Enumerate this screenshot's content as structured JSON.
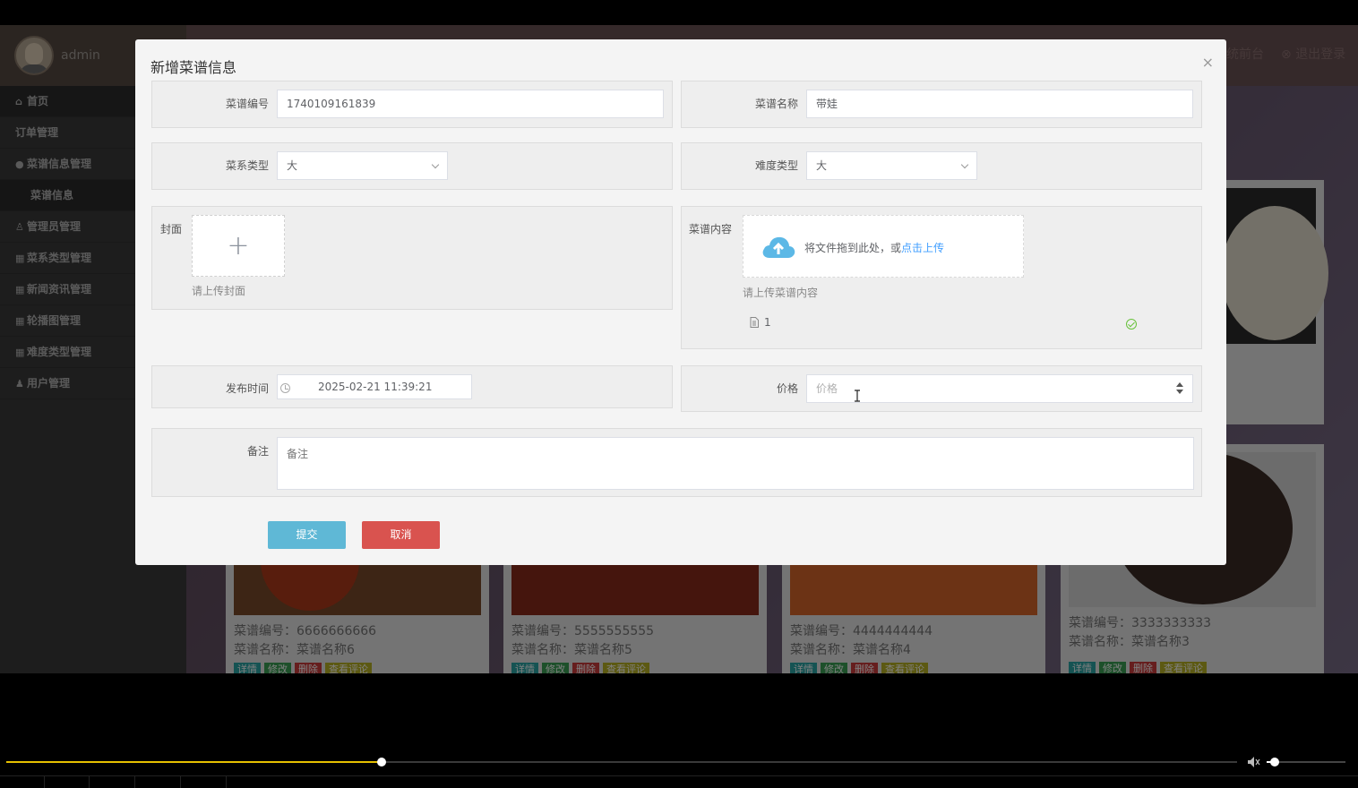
{
  "sidebar": {
    "user": "admin",
    "items": [
      {
        "label": "首页",
        "icon": "home-icon"
      },
      {
        "label": "订单管理",
        "icon": ""
      },
      {
        "label": "菜谱信息管理",
        "icon": "circle-icon"
      },
      {
        "label": "菜谱信息",
        "icon": ""
      },
      {
        "label": "管理员管理",
        "icon": "user-shield-icon"
      },
      {
        "label": "菜系类型管理",
        "icon": "grid-icon"
      },
      {
        "label": "新闻资讯管理",
        "icon": "grid-icon"
      },
      {
        "label": "轮播图管理",
        "icon": "grid-icon"
      },
      {
        "label": "难度类型管理",
        "icon": "grid-icon"
      },
      {
        "label": "用户管理",
        "icon": "user-icon"
      }
    ]
  },
  "topbar": {
    "frontend_label": "统前台",
    "logout_label": "退出登录"
  },
  "cards": [
    {
      "code": "菜谱编号：6666666666",
      "name": "菜谱名称：菜谱名称6"
    },
    {
      "code": "菜谱编号：5555555555",
      "name": "菜谱名称：菜谱名称5"
    },
    {
      "code": "菜谱编号：4444444444",
      "name": "菜谱名称：菜谱名称4"
    },
    {
      "code": "菜谱编号：3333333333",
      "name": "菜谱名称：菜谱名称3"
    }
  ],
  "card_buttons": {
    "detail": "详情",
    "edit": "修改",
    "delete": "删除",
    "comments": "查看评论"
  },
  "modal": {
    "title": "新增菜谱信息",
    "close": "×",
    "fields": {
      "code_label": "菜谱编号",
      "code_value": "1740109161839",
      "name_label": "菜谱名称",
      "name_value": "带娃",
      "cuisine_label": "菜系类型",
      "cuisine_value": "大",
      "difficulty_label": "难度类型",
      "difficulty_value": "大",
      "cover_label": "封面",
      "cover_hint": "请上传封面",
      "content_label": "菜谱内容",
      "upload_text": "将文件拖到此处，或",
      "upload_link": "点击上传",
      "content_hint": "请上传菜谱内容",
      "file_name": "1",
      "publish_label": "发布时间",
      "publish_value": "2025-02-21 11:39:21",
      "price_label": "价格",
      "price_placeholder": "价格",
      "remark_label": "备注",
      "remark_placeholder": "备注"
    },
    "submit": "提交",
    "cancel": "取消"
  },
  "player": {
    "progress": 0.305,
    "volume": 0.1
  },
  "colors": {
    "accent_link": "#409eff",
    "submit": "#5fb8d6",
    "cancel": "#d9534f",
    "progress": "#e6c000"
  }
}
